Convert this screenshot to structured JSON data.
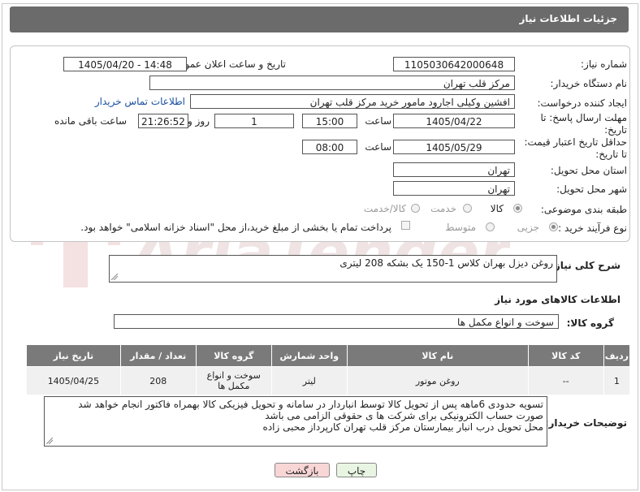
{
  "page_title": "جزئیات اطلاعات نیاز",
  "fields": {
    "need_number_label": "شماره نیاز:",
    "need_number": "1105030642000648",
    "announce_label": "تاریخ و ساعت اعلان عمومی:",
    "announce_value": "1405/04/20 - 14:48",
    "buyer_org_label": "نام دستگاه خریدار:",
    "buyer_org": "مرکز قلب تهران",
    "creator_label": "ایجاد کننده درخواست:",
    "creator": "افشین وکیلی اجارود مامور خرید مرکز قلب تهران",
    "contact_link": "اطلاعات تماس خریدار",
    "reply_deadline_label": "مهلت ارسال پاسخ: تا تاریخ:",
    "reply_date": "1405/04/22",
    "time_label": "ساعت",
    "reply_time": "15:00",
    "days_value": "1",
    "days_label": "روز و",
    "remaining_time": "21:26:52",
    "remaining_label": "ساعت باقی مانده",
    "price_validity_label": "حداقل تاریخ اعتبار قیمت: تا تاریخ:",
    "price_date": "1405/05/29",
    "price_time": "08:00",
    "province_label": "استان محل تحویل:",
    "province": "تهران",
    "city_label": "شهر محل تحویل:",
    "city": "تهران",
    "category_label": "طبقه بندی موضوعی:",
    "category_goods": "کالا",
    "category_service": "خدمت",
    "category_both": "کالا/خدمت",
    "process_label": "نوع فرآیند خرید :",
    "process_partial": "جزیی",
    "process_medium": "متوسط",
    "payment_note": "پرداخت تمام یا بخشی از مبلغ خرید،از محل \"اسناد خزانه اسلامی\" خواهد بود."
  },
  "description": {
    "label": "شرح کلی نیاز:",
    "text": "روغن دیزل بهران کلاس 1-150 یک بشکه 208 لیتری"
  },
  "goods_section": {
    "title": "اطلاعات کالاهای مورد نیاز",
    "group_label": "گروه کالا:",
    "group_value": "سوخت و انواع مکمل ها"
  },
  "table": {
    "headers": [
      "ردیف",
      "کد کالا",
      "نام کالا",
      "واحد شمارش",
      "گروه کالا",
      "تعداد / مقدار",
      "تاریخ نیاز"
    ],
    "rows": [
      [
        "1",
        "--",
        "روغن موتور",
        "لیتر",
        "سوخت و انواع مکمل ها",
        "208",
        "1405/04/25"
      ]
    ]
  },
  "buyer_notes": {
    "label": "توضیحات خریدار:",
    "lines": [
      "تسویه حدودی 6ماهه پس از تحویل کالا توسط انباردار در سامانه و تحویل فیزیکی کالا بهمراه فاکتور انجام خواهد شد",
      "صورت حساب الکترونیکی برای شرکت ها ی حقوقی الزامی می باشد",
      "محل تحویل درب انبار بیمارستان مرکز قلب تهران کارپرداز محبی زاده"
    ]
  },
  "buttons": {
    "print": "چاپ",
    "back": "بازگشت"
  },
  "watermark_text": "AriaTender.neT",
  "colors": {
    "title_bar": "#6b6b6b",
    "link": "#1a4fa0",
    "back_button": "#f9d6d6",
    "print_button": "#e9f5e3"
  }
}
